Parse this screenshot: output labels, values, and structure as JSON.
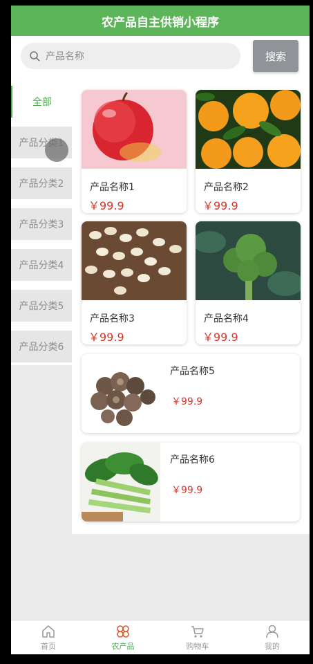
{
  "app": {
    "title": "农产品自主供销小程序"
  },
  "search": {
    "placeholder": "产品名称",
    "button_label": "搜索"
  },
  "sidebar": {
    "items": [
      {
        "label": "全部",
        "active": true
      },
      {
        "label": "产品分类1"
      },
      {
        "label": "产品分类2"
      },
      {
        "label": "产品分类3"
      },
      {
        "label": "产品分类4"
      },
      {
        "label": "产品分类5"
      },
      {
        "label": "产品分类6"
      }
    ]
  },
  "products": [
    {
      "name": "产品名称1",
      "price": "￥99.9",
      "image": "apple"
    },
    {
      "name": "产品名称2",
      "price": "￥99.9",
      "image": "oranges"
    },
    {
      "name": "产品名称3",
      "price": "￥99.9",
      "image": "garlic"
    },
    {
      "name": "产品名称4",
      "price": "￥99.9",
      "image": "broccoli"
    },
    {
      "name": "产品名称5",
      "price": "￥99.9",
      "image": "mushrooms"
    },
    {
      "name": "产品名称6",
      "price": "￥99.9",
      "image": "greens"
    }
  ],
  "tabbar": {
    "items": [
      {
        "label": "首页",
        "icon": "home-icon"
      },
      {
        "label": "农产品",
        "icon": "grid-icon",
        "active": true
      },
      {
        "label": "购物车",
        "icon": "cart-icon"
      },
      {
        "label": "我的",
        "icon": "user-icon"
      }
    ]
  },
  "colors": {
    "brand": "#5db55a",
    "active": "#4caf50",
    "price": "#d9362b",
    "button": "#909398"
  }
}
